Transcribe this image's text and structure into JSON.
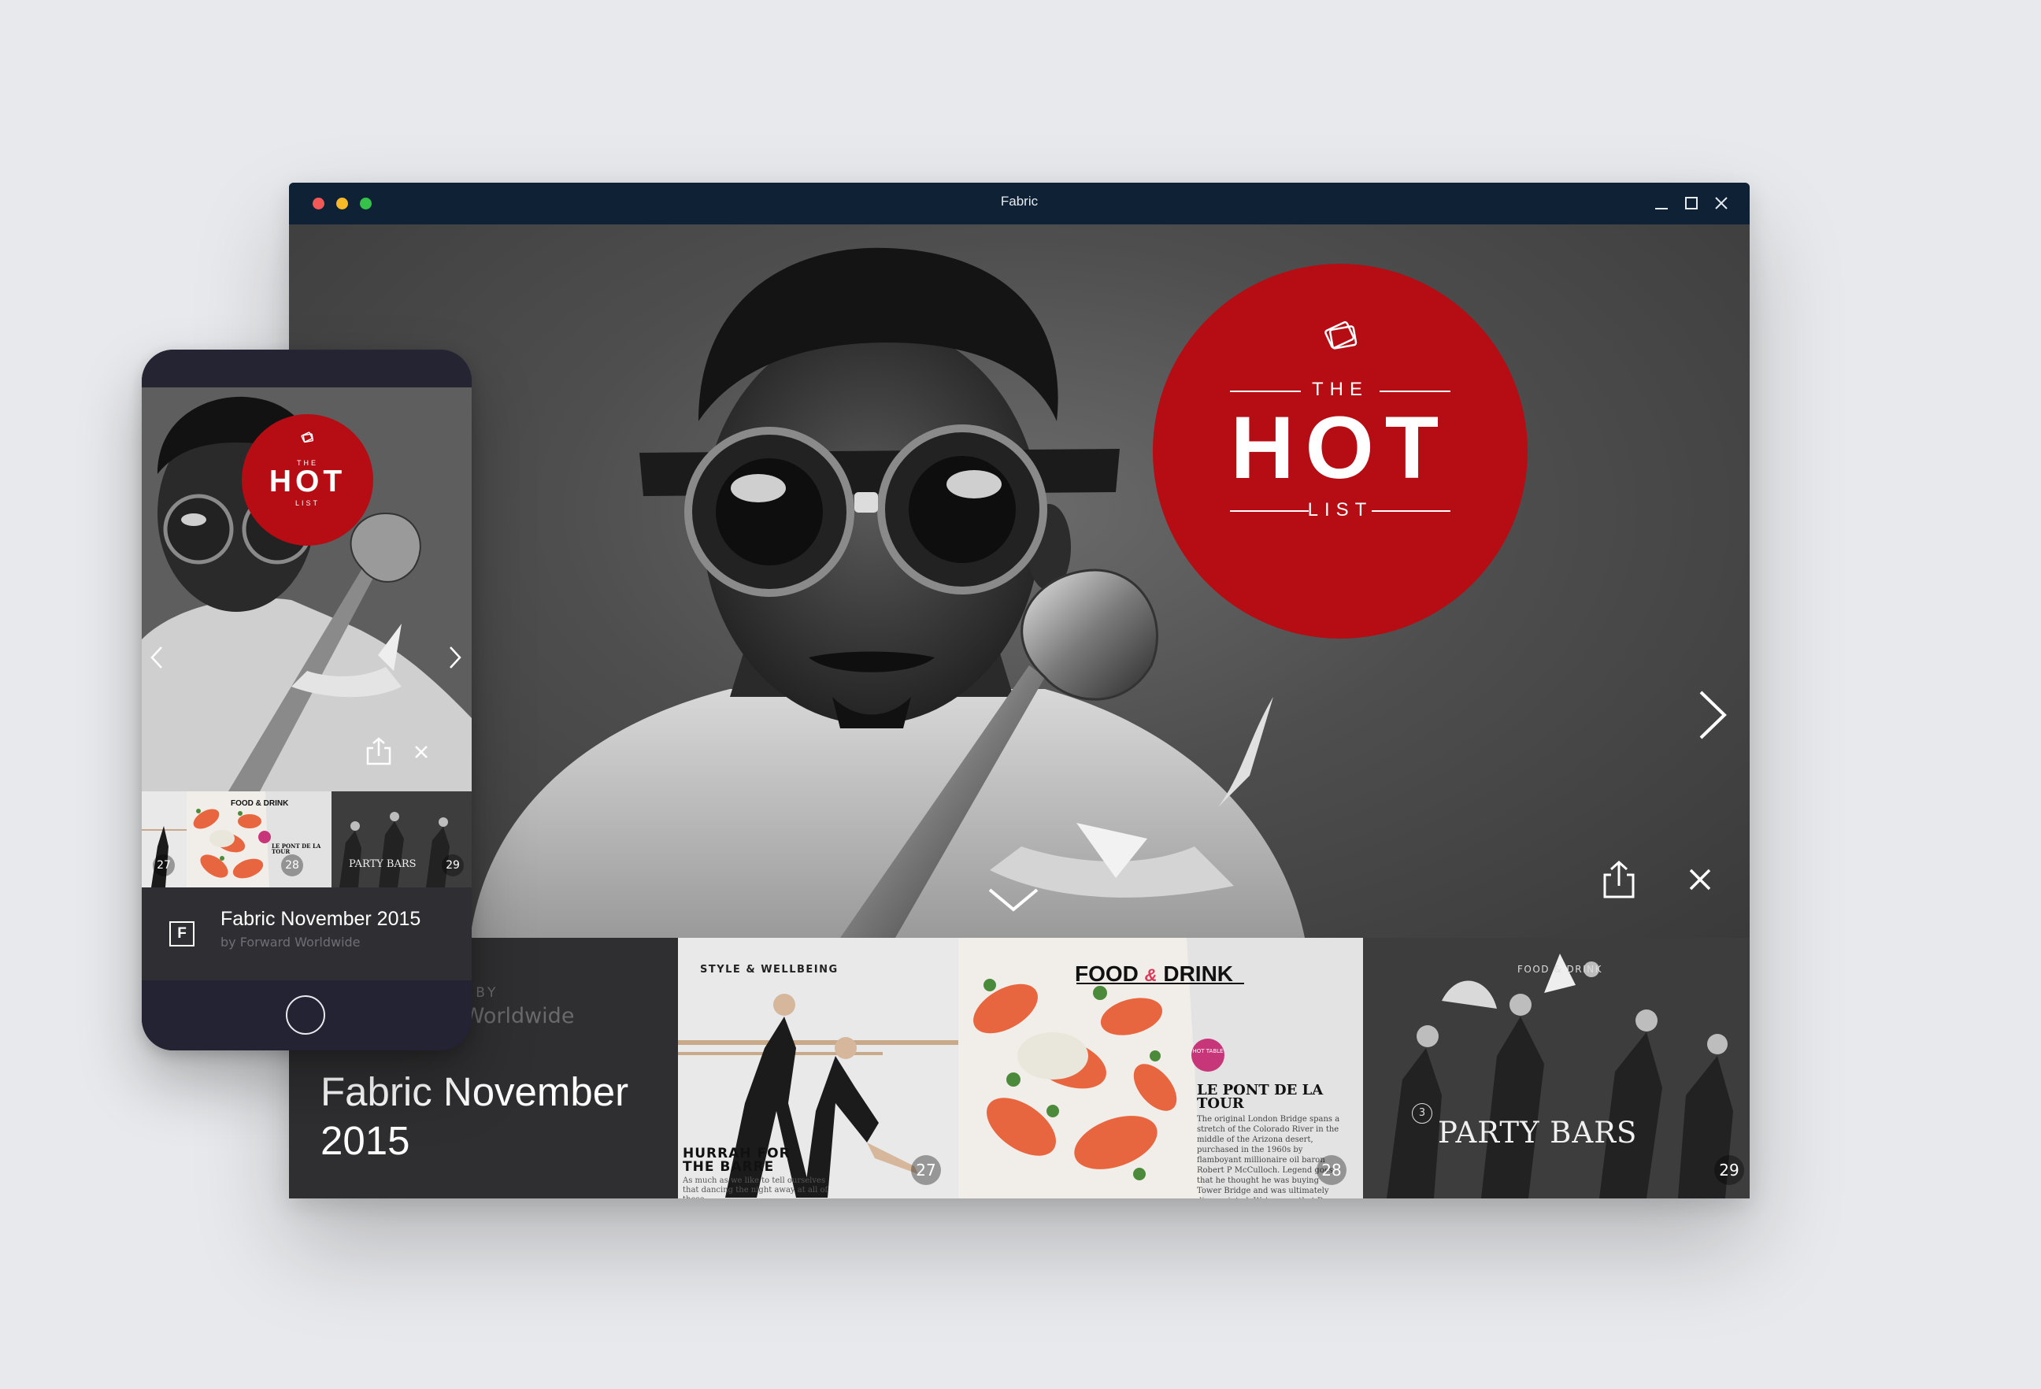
{
  "window": {
    "title": "Fabric",
    "controls": [
      "minimize-icon",
      "maximize-icon",
      "close-icon"
    ]
  },
  "hero": {
    "badge": {
      "the": "THE",
      "hot": "HOT",
      "list": "LIST",
      "color": "#b50d13"
    },
    "icons": [
      "chevron-right-icon",
      "share-icon",
      "close-icon"
    ]
  },
  "issue": {
    "published_label": "ED BY",
    "publisher": "d Worldwide",
    "title": "Fabric November 2015"
  },
  "pages": [
    {
      "page": "27",
      "section": "STYLE & WELLBEING",
      "headline": "HURRAH FOR THE BARRE",
      "body": "As much as we like to tell ourselves that dancing the night away at all of those"
    },
    {
      "page": "28",
      "section_a": "FOOD",
      "section_amp": "&",
      "section_b": "DRINK",
      "badge": "HOT TABLE",
      "headline": "LE PONT DE LA TOUR",
      "body": "The original London Bridge spans a stretch of the Colorado River in the middle of the Arizona desert, purchased in the 1960s by flamboyant millionaire oil baron Robert P McCulloch. Legend goes that he thought he was buying Tower Bridge and was ultimately disappointed. We're sure that Des"
    },
    {
      "page": "29",
      "section": "FOOD & DRINK",
      "number": "3",
      "headline": "PARTY BARS"
    }
  ],
  "phone": {
    "badge": {
      "the": "THE",
      "hot": "HOT",
      "list": "LIST"
    },
    "pages": [
      "27",
      "28",
      "29"
    ],
    "thumb_food": "FOOD & DRINK",
    "thumb_lepont": "LE PONT DE LA TOUR",
    "thumb_party": "PARTY BARS",
    "publication_logo": "F",
    "title": "Fabric November 2015",
    "subtitle": "by Forward Worldwide"
  }
}
